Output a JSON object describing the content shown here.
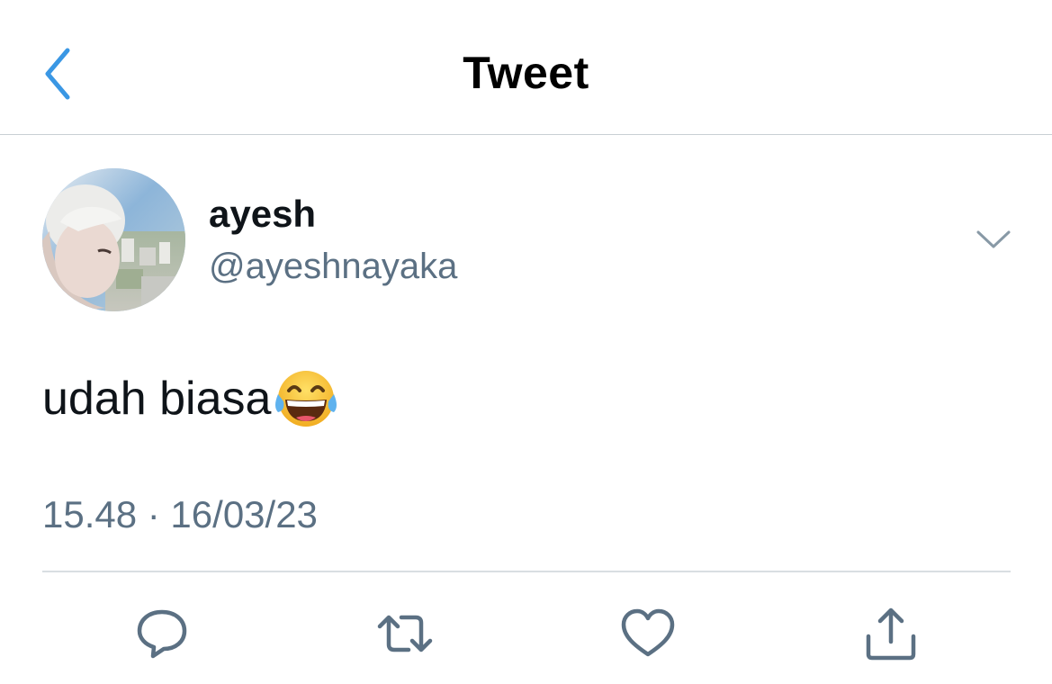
{
  "header": {
    "title": "Tweet",
    "back_icon": "chevron-left-icon"
  },
  "tweet": {
    "author": {
      "display_name": "ayesh",
      "handle": "@ayeshnayaka"
    },
    "text": "udah biasa",
    "emoji": "face-with-tears-of-joy",
    "timestamp": "15.48 · 16/03/23"
  },
  "actions": [
    {
      "name": "reply",
      "icon": "speech-bubble-icon"
    },
    {
      "name": "retweet",
      "icon": "retweet-icon"
    },
    {
      "name": "like",
      "icon": "heart-icon"
    },
    {
      "name": "share",
      "icon": "share-icon"
    }
  ],
  "colors": {
    "accent": "#1d9bf0",
    "secondary_text": "#5b7083",
    "icon_gray": "#5b7083",
    "divider": "#d9dee2"
  }
}
